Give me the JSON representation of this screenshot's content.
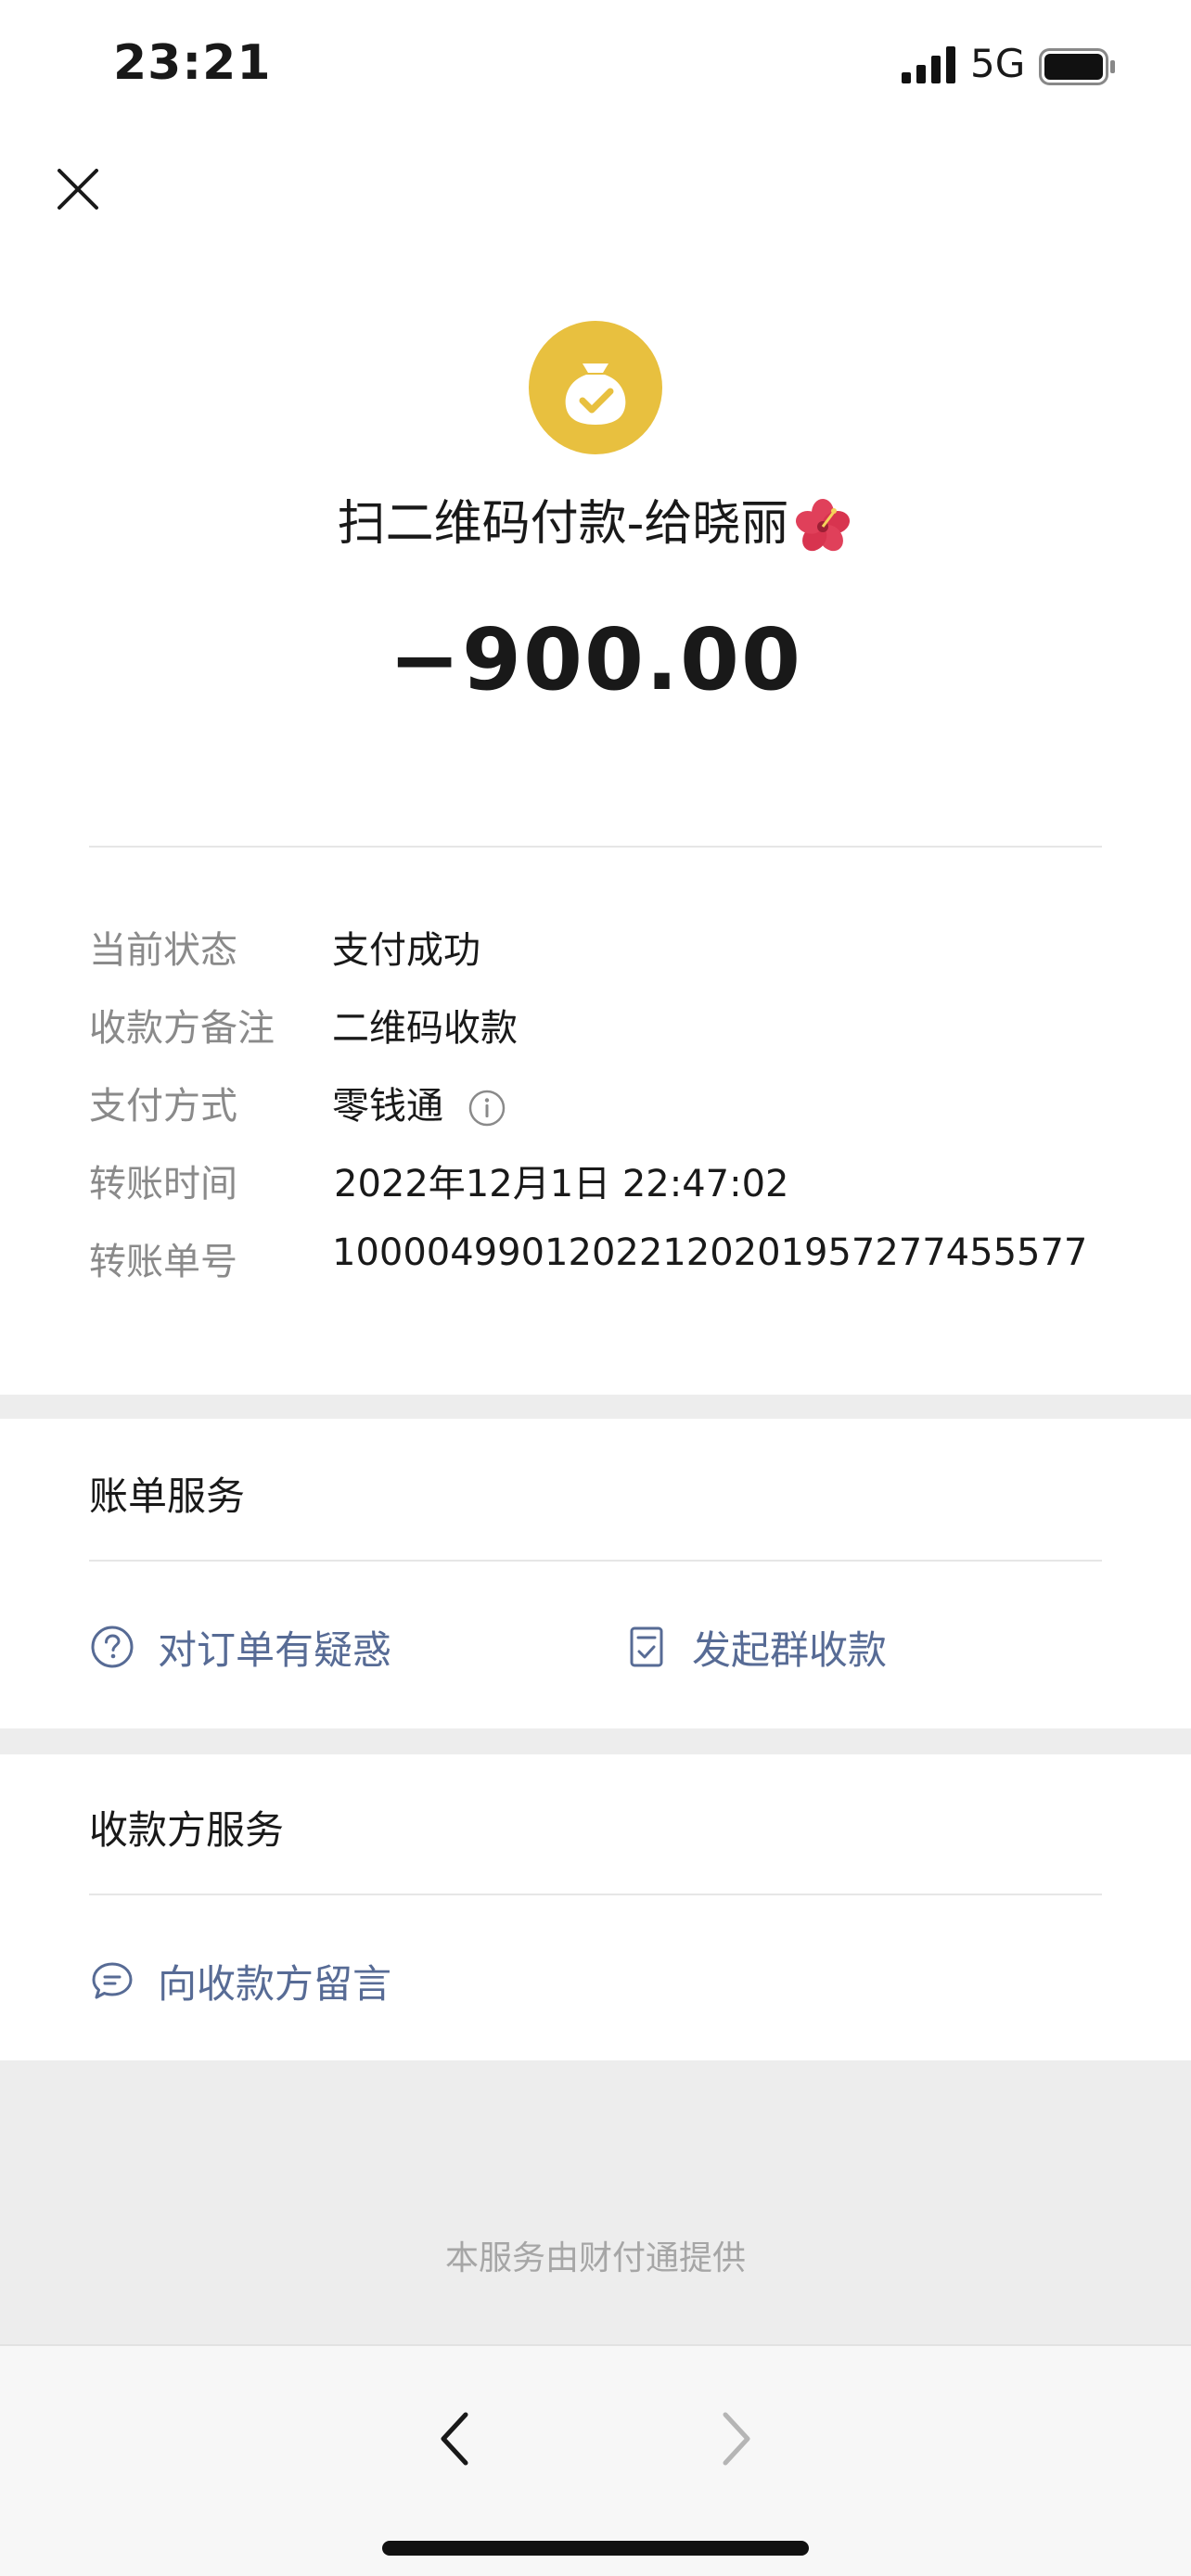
{
  "status_bar": {
    "time": "23:21",
    "network": "5G",
    "icons": [
      "signal-icon",
      "battery-icon"
    ]
  },
  "header": {
    "close_icon": "close-icon",
    "payee_icon": "money-bag-check-icon",
    "title": "扫二维码付款-给晓丽",
    "title_emoji": "hibiscus-emoji",
    "amount": "−900.00",
    "accent_color": "#e8c03f"
  },
  "details": [
    {
      "label": "当前状态",
      "value": "支付成功"
    },
    {
      "label": "收款方备注",
      "value": "二维码收款"
    },
    {
      "label": "支付方式",
      "value": "零钱通"
    },
    {
      "label": "转账时间",
      "value": "2022年12月1日 22:47:02"
    },
    {
      "label": "转账单号",
      "value": "10000499012022120201957277455577"
    }
  ],
  "bill_services": {
    "title": "账单服务",
    "actions": [
      {
        "label": "对订单有疑惑",
        "icon": "question-circle-icon"
      },
      {
        "label": "发起群收款",
        "icon": "checklist-icon"
      }
    ]
  },
  "payee_services": {
    "title": "收款方服务",
    "actions": [
      {
        "label": "向收款方留言",
        "icon": "chat-bubble-icon"
      }
    ]
  },
  "footer": {
    "text": "本服务由财付通提供"
  },
  "nav": {
    "back_icon": "chevron-left-icon",
    "forward_icon": "chevron-right-icon"
  },
  "colors": {
    "link": "#576b95",
    "label": "#8a8a8a",
    "band": "#ededed"
  }
}
